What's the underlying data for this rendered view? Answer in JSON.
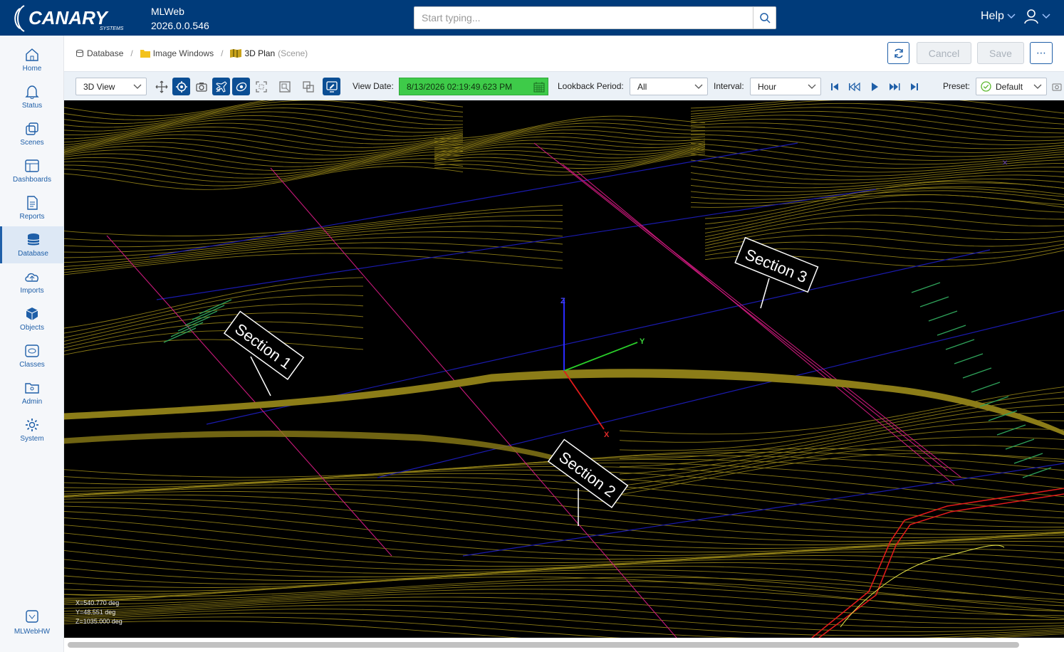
{
  "header": {
    "app_name": "MLWeb",
    "version": "2026.0.0.546",
    "search_placeholder": "Start typing...",
    "help_label": "Help",
    "logo_text": "CANARY",
    "logo_sub": "SYSTEMS"
  },
  "sidebar": {
    "items": [
      {
        "label": "Home",
        "icon": "home-icon"
      },
      {
        "label": "Status",
        "icon": "bell-icon"
      },
      {
        "label": "Scenes",
        "icon": "scenes-icon"
      },
      {
        "label": "Dashboards",
        "icon": "dashboard-icon"
      },
      {
        "label": "Reports",
        "icon": "report-icon"
      },
      {
        "label": "Database",
        "icon": "database-icon",
        "active": true
      },
      {
        "label": "Imports",
        "icon": "cloud-upload-icon"
      },
      {
        "label": "Objects",
        "icon": "cube-icon"
      },
      {
        "label": "Classes",
        "icon": "classes-icon"
      },
      {
        "label": "Admin",
        "icon": "admin-folder-icon"
      },
      {
        "label": "System",
        "icon": "gear-icon"
      }
    ],
    "footer_label": "MLWebHW"
  },
  "breadcrumb": {
    "items": [
      "Database",
      "Image Windows",
      "3D Plan"
    ],
    "scene_tag": "(Scene)"
  },
  "actions": {
    "cancel": "Cancel",
    "save": "Save",
    "more": "⋯"
  },
  "toolbar": {
    "view_mode": "3D View",
    "view_date_label": "View Date:",
    "view_date": "8/13/2026 02:19:49.623 PM",
    "lookback_label": "Lookback Period:",
    "lookback_value": "All",
    "interval_label": "Interval:",
    "interval_value": "Hour",
    "preset_label": "Preset:",
    "preset_value": "Default"
  },
  "viewport": {
    "sections": [
      "Section 1",
      "Section 2",
      "Section 3"
    ],
    "axes": {
      "x": "X",
      "y": "Y",
      "z": "Z"
    },
    "coord_x": "X=540.770 deg",
    "coord_y": "Y=48.551 deg",
    "coord_z": "Z=1035.000 deg",
    "colors": {
      "contour": "#8a7a16",
      "road": "#8c7d18",
      "section_line": "#d0187a",
      "grid": "#1a1aa8"
    }
  }
}
